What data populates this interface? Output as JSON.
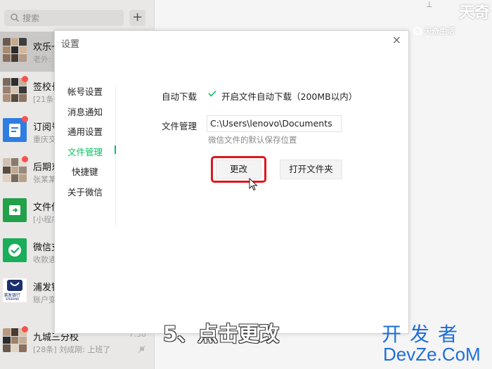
{
  "sidebar": {
    "search_placeholder": "搜索",
    "plus_label": "+",
    "chats": [
      {
        "name": "欢乐一",
        "preview": "老外:",
        "time": "",
        "avatar": "group-grid"
      },
      {
        "name": "签校长",
        "preview": "[21条",
        "time": "",
        "avatar": "group-grid"
      },
      {
        "name": "订阅号",
        "preview": "重庆交",
        "time": "",
        "avatar": "blue-doc-icon"
      },
      {
        "name": "后期东",
        "preview": "张某某",
        "time": "",
        "avatar": "group-grid"
      },
      {
        "name": "文件传",
        "preview": "[小程序",
        "time": "",
        "avatar": "green-file-icon"
      },
      {
        "name": "微信支",
        "preview": "收款通",
        "time": "",
        "avatar": "green-pay-icon"
      },
      {
        "name": "浦发银",
        "preview": "账户变",
        "time": "",
        "avatar": "spdb-logo",
        "logo_text": "浦发银行",
        "logo_sub": "SPDBANK"
      },
      {
        "name": "九城三分校",
        "preview": "[28条] 刘成刚: 上班了",
        "time": "7:30",
        "avatar": "group-grid"
      }
    ]
  },
  "watermarks": {
    "tianqi": "天奇",
    "shenghuo": "天奇生活",
    "devze_cn": "开发者",
    "devze": "DevZe.CoM"
  },
  "dialog": {
    "title": "设置",
    "close": "×",
    "nav": [
      "帐号设置",
      "消息通知",
      "通用设置",
      "文件管理",
      "快捷键",
      "关于微信"
    ],
    "auto_download_label": "自动下载",
    "auto_download_option": "开启文件自动下载（200MB以内）",
    "auto_download_checked": true,
    "file_manage_label": "文件管理",
    "path_value": "C:\\Users\\lenovo\\Documents",
    "path_hint": "微信文件的默认保存位置",
    "change_button": "更改",
    "open_folder_button": "打开文件夹"
  },
  "caption": "5、点击更改",
  "colors": {
    "accent_green": "#07c160",
    "highlight_red": "#e0161b",
    "watermark_blue": "#1e6fd9",
    "badge_red": "#fa5151"
  }
}
